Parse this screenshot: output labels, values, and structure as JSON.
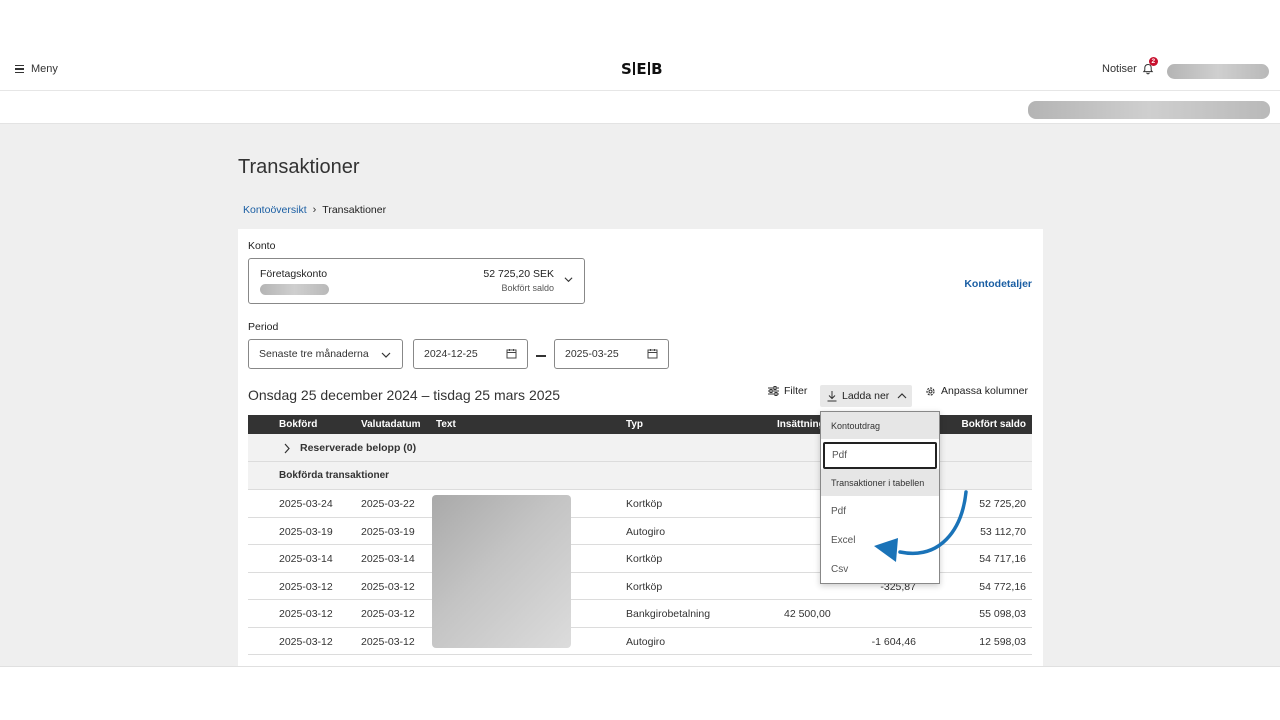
{
  "header": {
    "menu_label": "Meny",
    "logo_text": "SEB",
    "notiser_label": "Notiser",
    "notification_count": "2"
  },
  "page": {
    "title": "Transaktioner",
    "breadcrumb": {
      "parent": "Kontoöversikt",
      "current": "Transaktioner"
    }
  },
  "account": {
    "label": "Konto",
    "name": "Företagskonto",
    "amount": "52 725,20 SEK",
    "amount_sub": "Bokfört saldo",
    "details_link": "Kontodetaljer"
  },
  "period": {
    "label": "Period",
    "selected": "Senaste tre månaderna",
    "from": "2024-12-25",
    "to": "2025-03-25",
    "range_text": "Onsdag 25 december 2024 – tisdag 25 mars 2025"
  },
  "toolbar": {
    "filter": "Filter",
    "download": "Ladda ner",
    "columns": "Anpassa kolumner"
  },
  "table": {
    "headers": [
      "Bokförd",
      "Valutadatum",
      "Text",
      "Typ",
      "Insättning",
      "Bokfört saldo"
    ],
    "reserved_label": "Reserverade belopp (0)",
    "booked_label": "Bokförda transaktioner",
    "rows": [
      {
        "booked": "2025-03-24",
        "value_date": "2025-03-22",
        "type": "Kortköp",
        "amount": "",
        "balance": "52 725,20"
      },
      {
        "booked": "2025-03-19",
        "value_date": "2025-03-19",
        "type": "Autogiro",
        "amount": "",
        "balance": "53 112,70"
      },
      {
        "booked": "2025-03-14",
        "value_date": "2025-03-14",
        "type": "Kortköp",
        "amount": "",
        "balance": "54 717,16"
      },
      {
        "booked": "2025-03-12",
        "value_date": "2025-03-12",
        "type": "Kortköp",
        "amount": "-325,87",
        "balance": "54 772,16"
      },
      {
        "booked": "2025-03-12",
        "value_date": "2025-03-12",
        "type": "Bankgirobetalning",
        "amount": "42 500,00",
        "balance": "55 098,03"
      },
      {
        "booked": "2025-03-12",
        "value_date": "2025-03-12",
        "type": "Autogiro",
        "amount": "-1 604,46",
        "balance": "12 598,03"
      }
    ]
  },
  "download_menu": {
    "group1": "Kontoutdrag",
    "group1_items": [
      "Pdf"
    ],
    "group2": "Transaktioner i tabellen",
    "group2_items": [
      "Pdf",
      "Excel",
      "Csv"
    ]
  },
  "colors": {
    "link": "#1a5ea3",
    "header_dark": "#333333",
    "arrow": "#1a73b8",
    "badge": "#c8102e"
  }
}
